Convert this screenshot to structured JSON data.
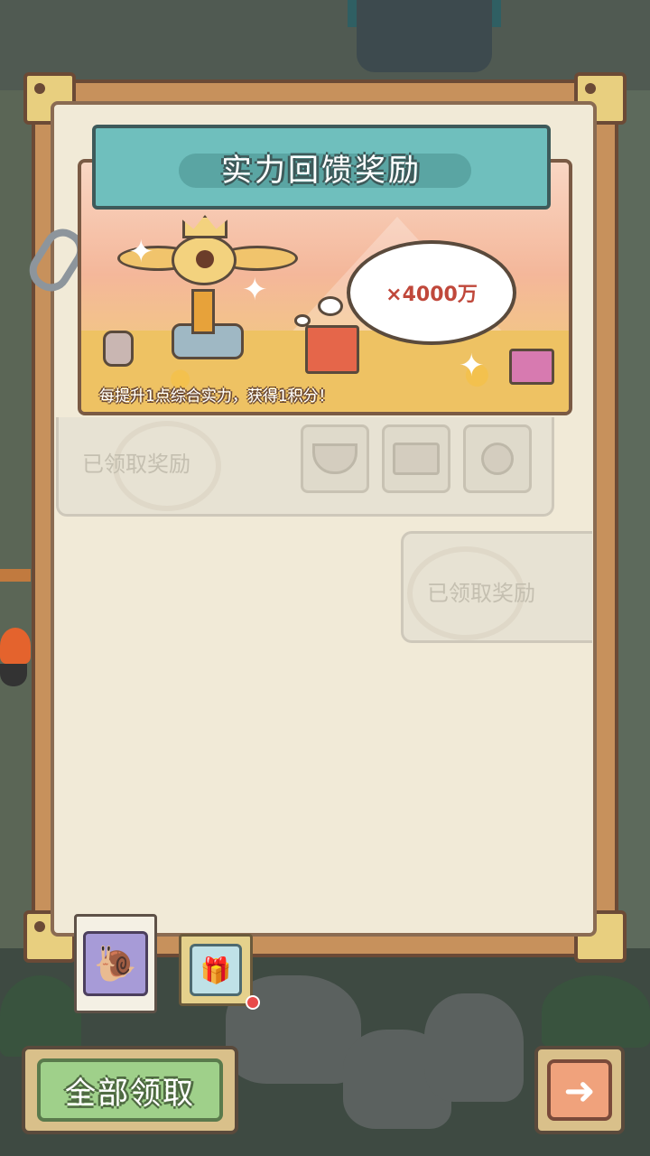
{
  "banner": {
    "title": "实力回馈奖励",
    "multiplier": "×4000万",
    "description": "每提升1点综合实力，获得1积分！"
  },
  "rewards": [
    {
      "status": "已领取奖励",
      "items": [
        "bowl-icon",
        "box-icon",
        "spoon-icon"
      ]
    },
    {
      "status": "已领取奖励",
      "items": []
    }
  ],
  "tabs": [
    {
      "icon": "snail-icon",
      "active": true
    },
    {
      "icon": "gift-box-icon",
      "active": false,
      "notification": true
    }
  ],
  "footer": {
    "claim_all_label": "全部领取",
    "next_icon": "arrow-right-icon"
  }
}
